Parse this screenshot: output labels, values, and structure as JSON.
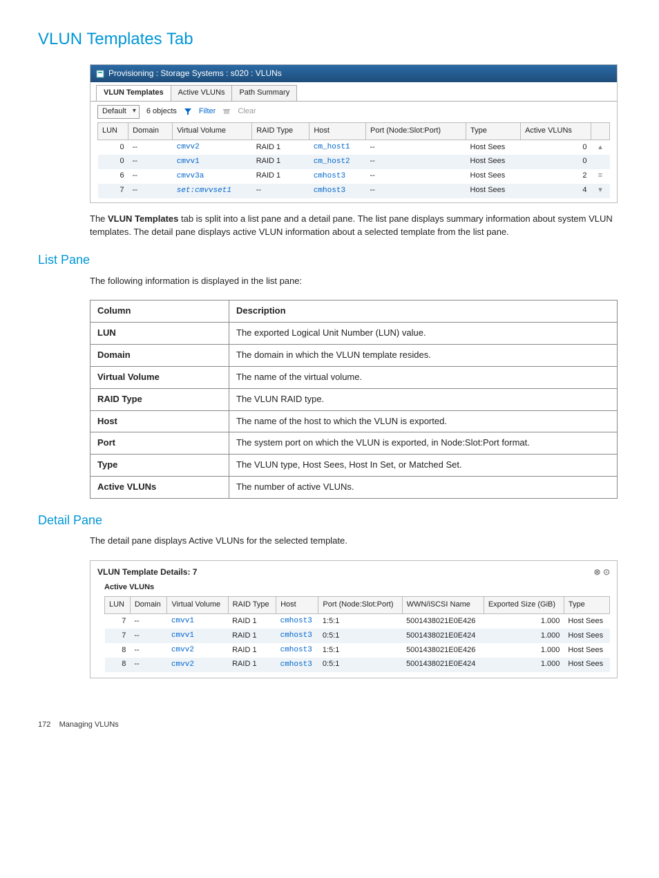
{
  "page": {
    "title": "VLUN Templates Tab",
    "footer_page": "172",
    "footer_text": "Managing VLUNs"
  },
  "screenshot1": {
    "breadcrumb": "Provisioning : Storage Systems : s020 : VLUNs",
    "tabs": [
      "VLUN Templates",
      "Active VLUNs",
      "Path Summary"
    ],
    "toolbar": {
      "scope": "Default",
      "count": "6 objects",
      "filter": "Filter",
      "clear": "Clear"
    },
    "columns": [
      "LUN",
      "Domain",
      "Virtual Volume",
      "RAID Type",
      "Host",
      "Port (Node:Slot:Port)",
      "Type",
      "Active VLUNs"
    ],
    "rows": [
      {
        "lun": "0",
        "domain": "--",
        "vv": "cmvv2",
        "vvclass": "vv-link",
        "raid": "RAID 1",
        "host": "cm_host1",
        "port": "--",
        "type": "Host Sees",
        "av": "0"
      },
      {
        "lun": "0",
        "domain": "--",
        "vv": "cmvv1",
        "vvclass": "vv-link",
        "raid": "RAID 1",
        "host": "cm_host2",
        "port": "--",
        "type": "Host Sees",
        "av": "0",
        "alt": true
      },
      {
        "lun": "6",
        "domain": "--",
        "vv": "cmvv3a",
        "vvclass": "vv-link",
        "raid": "RAID 1",
        "host": "cmhost3",
        "port": "--",
        "type": "Host Sees",
        "av": "2"
      },
      {
        "lun": "7",
        "domain": "--",
        "vv": "set:cmvvset1",
        "vvclass": "vv-set",
        "raid": "--",
        "host": "cmhost3",
        "port": "--",
        "type": "Host Sees",
        "av": "4",
        "alt": true
      }
    ]
  },
  "para1_pre": "The ",
  "para1_bold": "VLUN Templates",
  "para1_post": " tab is split into a list pane and a detail pane. The list pane displays summary information about system VLUN templates. The detail pane displays active VLUN information about a selected template from the list pane.",
  "list_pane": {
    "heading": "List Pane",
    "intro": "The following information is displayed in the list pane:",
    "header_col": "Column",
    "header_desc": "Description",
    "rows": [
      {
        "c": "LUN",
        "d": "The exported Logical Unit Number (LUN) value."
      },
      {
        "c": "Domain",
        "d": "The domain in which the VLUN template resides."
      },
      {
        "c": "Virtual Volume",
        "d": "The name of the virtual volume."
      },
      {
        "c": "RAID Type",
        "d": "The VLUN RAID type."
      },
      {
        "c": "Host",
        "d": "The name of the host to which the VLUN is exported."
      },
      {
        "c": "Port",
        "d": "The system port on which the VLUN is exported, in Node:Slot:Port format."
      },
      {
        "c": "Type",
        "d": "The VLUN type, Host Sees, Host In Set, or Matched Set."
      },
      {
        "c": "Active VLUNs",
        "d": "The number of active VLUNs."
      }
    ]
  },
  "detail_pane": {
    "heading": "Detail Pane",
    "intro": "The detail pane displays Active VLUNs for the selected template.",
    "title": "VLUN Template Details: 7",
    "sub": "Active VLUNs",
    "columns": [
      "LUN",
      "Domain",
      "Virtual Volume",
      "RAID Type",
      "Host",
      "Port (Node:Slot:Port)",
      "WWN/iSCSI Name",
      "Exported Size (GiB)",
      "Type"
    ],
    "rows": [
      {
        "lun": "7",
        "domain": "--",
        "vv": "cmvv1",
        "raid": "RAID 1",
        "host": "cmhost3",
        "port": "1:5:1",
        "wwn": "5001438021E0E426",
        "size": "1.000",
        "type": "Host Sees"
      },
      {
        "lun": "7",
        "domain": "--",
        "vv": "cmvv1",
        "raid": "RAID 1",
        "host": "cmhost3",
        "port": "0:5:1",
        "wwn": "5001438021E0E424",
        "size": "1.000",
        "type": "Host Sees",
        "alt": true
      },
      {
        "lun": "8",
        "domain": "--",
        "vv": "cmvv2",
        "raid": "RAID 1",
        "host": "cmhost3",
        "port": "1:5:1",
        "wwn": "5001438021E0E426",
        "size": "1.000",
        "type": "Host Sees"
      },
      {
        "lun": "8",
        "domain": "--",
        "vv": "cmvv2",
        "raid": "RAID 1",
        "host": "cmhost3",
        "port": "0:5:1",
        "wwn": "5001438021E0E424",
        "size": "1.000",
        "type": "Host Sees",
        "alt": true
      }
    ]
  }
}
